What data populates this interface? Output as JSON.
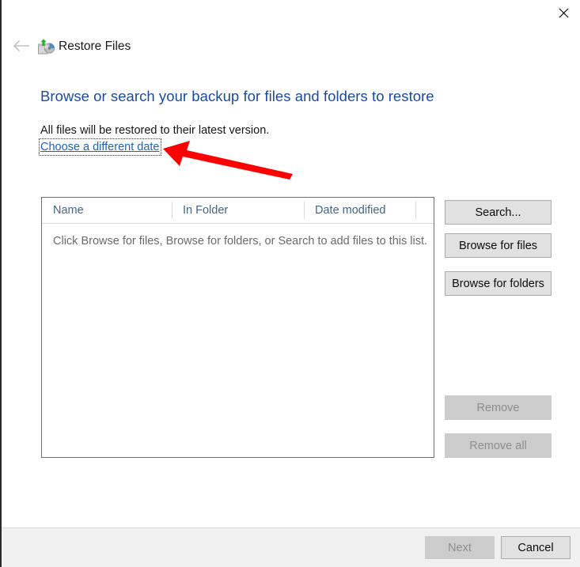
{
  "window": {
    "title": "Restore Files",
    "app_icon": "restore-files-icon",
    "back_icon": "back-arrow-icon",
    "close_icon": "close-icon"
  },
  "content": {
    "heading": "Browse or search your backup for files and folders to restore",
    "note": "All files will be restored to their latest version.",
    "choose_date_link": "Choose a different date"
  },
  "file_list": {
    "columns": [
      {
        "label": "Name"
      },
      {
        "label": "In Folder"
      },
      {
        "label": "Date modified"
      },
      {
        "label": ""
      }
    ],
    "empty_hint": "Click Browse for files, Browse for folders, or Search to add files to this list.",
    "rows": []
  },
  "side_buttons": [
    {
      "label": "Search...",
      "enabled": true
    },
    {
      "label": "Browse for files",
      "enabled": true
    },
    {
      "label": "Browse for folders",
      "enabled": true
    },
    {
      "label": "Remove",
      "enabled": false
    },
    {
      "label": "Remove all",
      "enabled": false
    }
  ],
  "footer_buttons": [
    {
      "label": "Next",
      "enabled": false
    },
    {
      "label": "Cancel",
      "enabled": true
    }
  ],
  "annotation": {
    "type": "arrow",
    "color": "#FF0000",
    "points_to": "choose-a-different-date-link",
    "direction": "left"
  },
  "colors": {
    "heading_blue": "#1B4B9E",
    "link_blue": "#1763C6",
    "column_header": "#41658B",
    "hint_gray": "#6B6B6B",
    "footer_bg": "#F0F0F0",
    "button_bg": "#E1E1E1",
    "button_border": "#ACACAC",
    "disabled_bg": "#CCCCCC",
    "disabled_text": "#8E8E8E",
    "annotation_red": "#FF0000"
  }
}
